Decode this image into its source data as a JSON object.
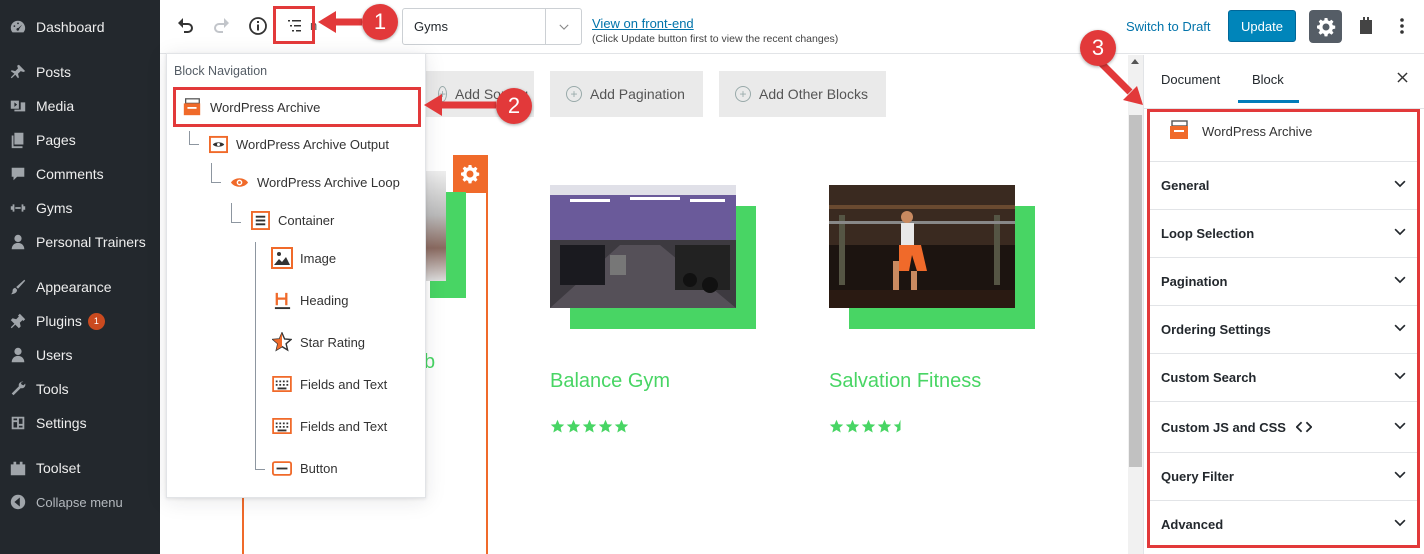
{
  "admin_menu": {
    "items": [
      {
        "label": "Dashboard",
        "icon": "dashboard-icon"
      },
      {
        "label": "Posts",
        "icon": "pin-icon"
      },
      {
        "label": "Media",
        "icon": "media-icon"
      },
      {
        "label": "Pages",
        "icon": "pages-icon"
      },
      {
        "label": "Comments",
        "icon": "comment-icon"
      },
      {
        "label": "Gyms",
        "icon": "gyms-icon"
      },
      {
        "label": "Personal Trainers",
        "icon": "user-icon"
      },
      {
        "label": "Appearance",
        "icon": "brush-icon"
      },
      {
        "label": "Plugins",
        "icon": "plugin-icon",
        "badge": "1"
      },
      {
        "label": "Users",
        "icon": "users-icon"
      },
      {
        "label": "Tools",
        "icon": "wrench-icon"
      },
      {
        "label": "Settings",
        "icon": "settings-icon"
      },
      {
        "label": "Toolset",
        "icon": "toolset-icon"
      }
    ],
    "collapse_label": "Collapse menu"
  },
  "toolbar": {
    "template_select_value": "Gyms",
    "view_frontend_label": "View on front-end",
    "view_frontend_hint": "(Click Update button first to view the recent changes)",
    "switch_draft_label": "Switch to Draft",
    "update_label": "Update",
    "partial_label": "n"
  },
  "canvas": {
    "buttons": [
      {
        "label": "Add Sorting"
      },
      {
        "label": "Add Pagination"
      },
      {
        "label": "Add Other Blocks"
      }
    ],
    "partial_title_fragment": "b",
    "gyms": [
      {
        "title": "Balance Gym",
        "rating_stars": 5
      },
      {
        "title": "Salvation Fitness",
        "rating_stars": 4.5
      }
    ]
  },
  "block_navigation": {
    "title": "Block Navigation",
    "items": [
      {
        "label": "WordPress Archive",
        "icon": "archive-icon"
      },
      {
        "label": "WordPress Archive Output",
        "icon": "eye-box-icon"
      },
      {
        "label": "WordPress Archive Loop",
        "icon": "eye-icon"
      },
      {
        "label": "Container",
        "icon": "container-icon"
      },
      {
        "label": "Image",
        "icon": "image-icon"
      },
      {
        "label": "Heading",
        "icon": "heading-icon"
      },
      {
        "label": "Star Rating",
        "icon": "star-icon"
      },
      {
        "label": "Fields and Text",
        "icon": "keyboard-icon"
      },
      {
        "label": "Fields and Text",
        "icon": "keyboard-icon"
      },
      {
        "label": "Button",
        "icon": "button-icon"
      }
    ]
  },
  "sidebar": {
    "tabs": [
      {
        "label": "Document"
      },
      {
        "label": "Block",
        "active": true
      }
    ],
    "block_title": "WordPress Archive",
    "panels": [
      {
        "label": "General"
      },
      {
        "label": "Loop Selection"
      },
      {
        "label": "Pagination"
      },
      {
        "label": "Ordering Settings"
      },
      {
        "label": "Custom Search"
      },
      {
        "label": "Custom JS and CSS",
        "has_code_icon": true
      },
      {
        "label": "Query Filter"
      },
      {
        "label": "Advanced"
      }
    ]
  },
  "callouts": [
    "1",
    "2",
    "3"
  ],
  "colors": {
    "admin_bg": "#23282d",
    "accent_blue": "#0085ba",
    "toolset_orange": "#f06a2a",
    "gym_green": "#48d564",
    "annotation_red": "#e2393a"
  }
}
